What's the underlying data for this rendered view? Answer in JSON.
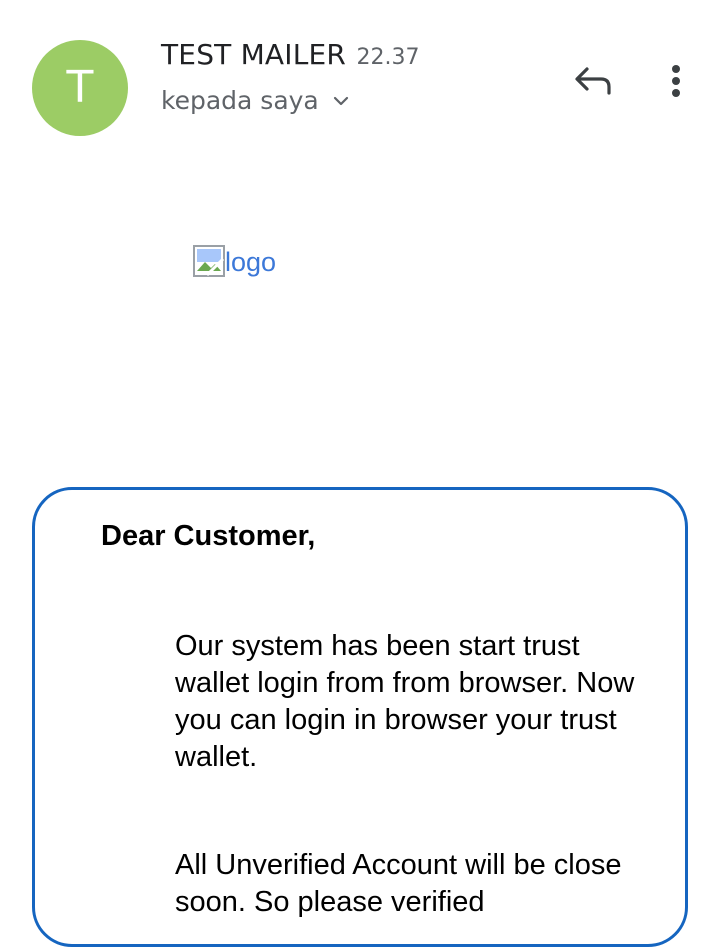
{
  "header": {
    "avatar_letter": "T",
    "avatar_color": "#9ccc65",
    "sender_name": "TEST MAILER",
    "time": "22.37",
    "recipient": "kepada saya",
    "expand_icon": "chevron-down-icon",
    "reply_icon": "reply-icon",
    "more_icon": "more-vert-icon"
  },
  "body": {
    "logo_alt": "logo",
    "greeting": "Dear Customer,",
    "paragraphs": [
      "Our system has been start trust wallet login from from browser. Now you can login in browser your trust wallet.",
      "All Unverified Account will be close soon. So please verified"
    ],
    "card_border_color": "#1565c0",
    "link_color": "#3c78d8"
  }
}
